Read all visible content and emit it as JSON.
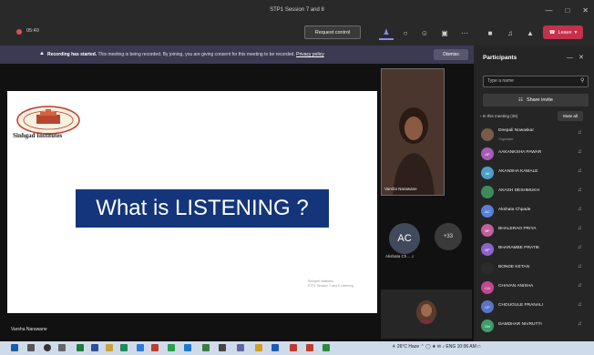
{
  "window": {
    "title": "STP1 Session 7 and 8"
  },
  "toolbar": {
    "timer": "05:40",
    "request_control_label": "Request control",
    "leave_label": "Leave"
  },
  "banner": {
    "bold": "Recording has started.",
    "text": "This meeting is being recorded. By joining, you are giving consent for this meeting to be recorded.",
    "link": "Privacy policy",
    "dismiss_label": "Dismiss"
  },
  "slide": {
    "logo_text": "Sinhgad Institutes",
    "headline": "What is LISTENING ?",
    "footer_line1": "Sinhgad Institutes",
    "footer_line2": "STP1 Session 7 and 8 Listening",
    "presenter_label": "Varsha Narawane"
  },
  "gallery": {
    "video_label": "Varsha Narawane",
    "ac_initials": "AC",
    "ac_label": "Akshata Ch...",
    "more_count": "+33"
  },
  "participants": {
    "title": "Participants",
    "search_placeholder": "Type a name",
    "share_label": "Share invite",
    "section_label": "In this meeting (36)",
    "mute_all_label": "Mute all",
    "items": [
      {
        "name": "Deepali Nowaskar",
        "role": "Organiser",
        "color": "#7a5a48",
        "initials": ""
      },
      {
        "name": "AAKANKSHA PAWAR",
        "role": "",
        "color": "#a55cb5",
        "initials": "AP"
      },
      {
        "name": "AKANSHA KAMALE",
        "role": "",
        "color": "#4aa0c8",
        "initials": "AK"
      },
      {
        "name": "AKASH DESHMUKH",
        "role": "",
        "color": "#3d8b5a",
        "initials": ""
      },
      {
        "name": "Akshata Chpade",
        "role": "",
        "color": "#5a7fd6",
        "initials": "AC"
      },
      {
        "name": "BHALERAO PRIYA",
        "role": "",
        "color": "#c0609a",
        "initials": "BP"
      },
      {
        "name": "BHARAMBE PRATIK",
        "role": "",
        "color": "#8e63c9",
        "initials": "BP"
      },
      {
        "name": "BONDE KETAN",
        "role": "",
        "color": "#2b2b2b",
        "initials": ""
      },
      {
        "name": "CHAVAN ANISHA",
        "role": "",
        "color": "#c04a8f",
        "initials": "CA"
      },
      {
        "name": "CHOUGULE PRANALI",
        "role": "",
        "color": "#5a73c7",
        "initials": "CP"
      },
      {
        "name": "DAMDHAR NIVRUTTI",
        "role": "",
        "color": "#3f9d6b",
        "initials": "DN"
      }
    ]
  },
  "taskbar": {
    "weather": "26°C Haze",
    "lang": "ENG",
    "time": "10:06 AM"
  }
}
